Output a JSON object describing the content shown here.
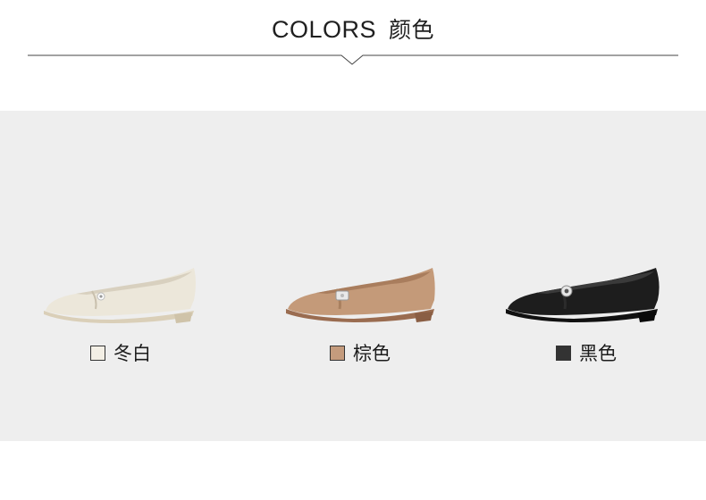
{
  "header": {
    "title_en": "COLORS",
    "title_zh": "颜色"
  },
  "colors": [
    {
      "label": "冬白",
      "swatch": "#f3efe5",
      "shoe_body": "#ece7da",
      "shoe_shade": "#d9d2c1",
      "sole": "#dacfb8"
    },
    {
      "label": "棕色",
      "swatch": "#c49b7d",
      "shoe_body": "#c49a79",
      "shoe_shade": "#a97d5d",
      "sole": "#9a6c50"
    },
    {
      "label": "黑色",
      "swatch": "#333333",
      "shoe_body": "#1d1d1d",
      "shoe_shade": "#3a3a3a",
      "sole": "#111111"
    }
  ]
}
